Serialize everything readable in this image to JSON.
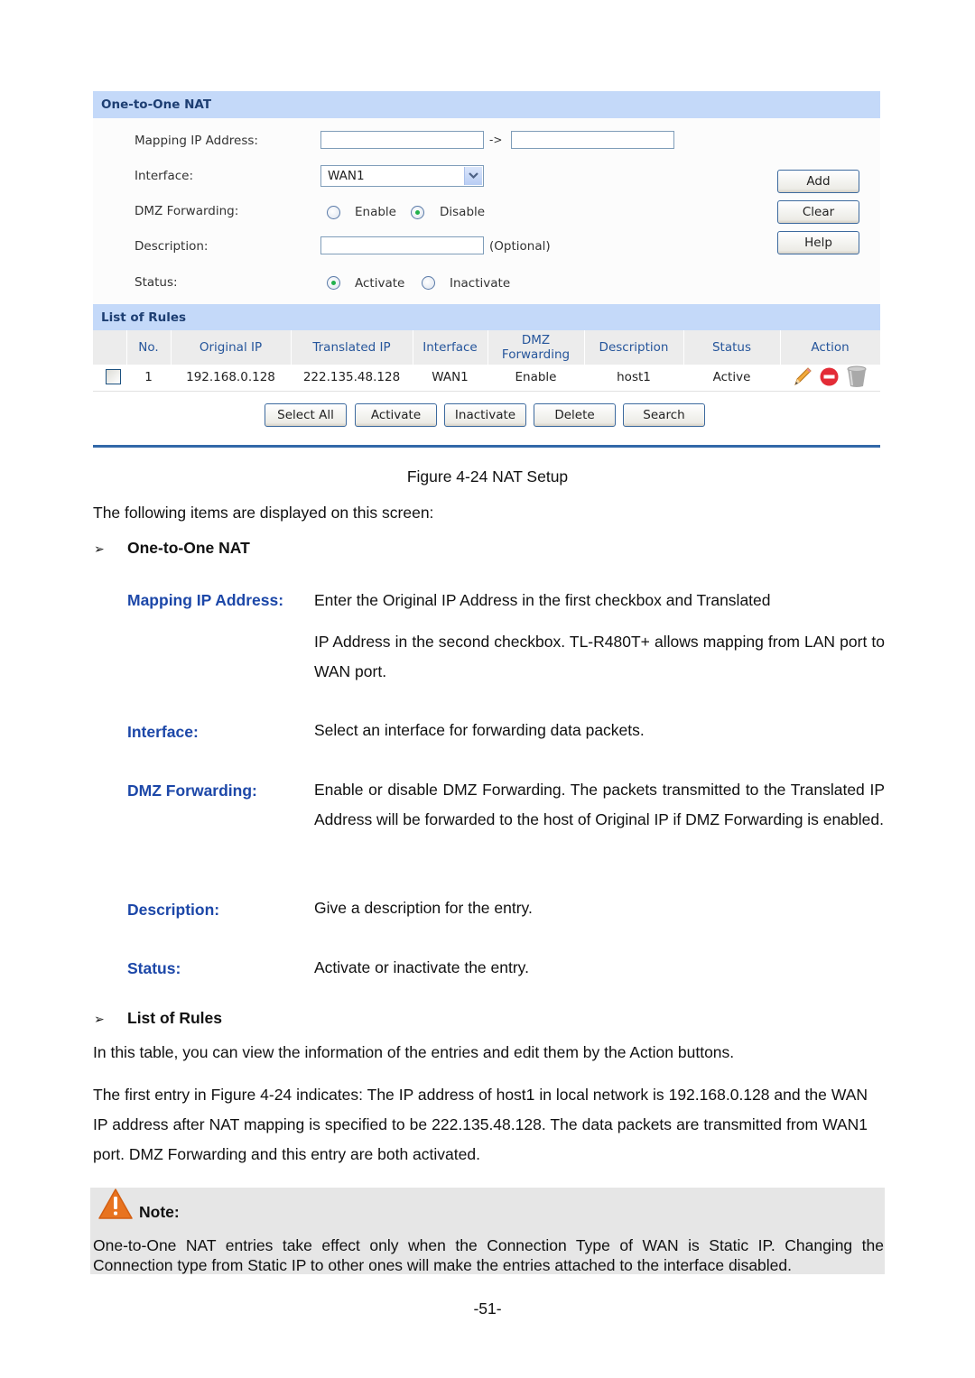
{
  "figure": {
    "one_to_one_section": {
      "title": "One-to-One NAT",
      "fields": {
        "mapping_ip_label": "Mapping IP Address:",
        "mapping_ip_original_value": "",
        "mapping_arrow": "->",
        "mapping_ip_translated_value": "",
        "interface_label": "Interface:",
        "interface_selected": "WAN1",
        "dmz_label": "DMZ Forwarding:",
        "dmz_options": [
          "Enable",
          "Disable"
        ],
        "dmz_selected": "Disable",
        "description_label": "Description:",
        "description_value": "",
        "description_hint": "(Optional)",
        "status_label": "Status:",
        "status_options": [
          "Activate",
          "Inactivate"
        ],
        "status_selected": "Activate"
      },
      "buttons": {
        "add": "Add",
        "clear": "Clear",
        "help": "Help"
      }
    },
    "rules_section": {
      "title": "List of Rules",
      "columns": [
        "",
        "No.",
        "Original IP",
        "Translated IP",
        "Interface",
        "DMZ Forwarding",
        "Description",
        "Status",
        "Action"
      ],
      "column_dmz_line1": "DMZ",
      "column_dmz_line2": "Forwarding",
      "rows": [
        {
          "checked": false,
          "no": "1",
          "original_ip": "192.168.0.128",
          "translated_ip": "222.135.48.128",
          "interface": "WAN1",
          "dmz_forwarding": "Enable",
          "description": "host1",
          "status": "Active",
          "actions": [
            "edit-pencil-icon",
            "inactivate-minus-icon",
            "delete-trash-icon"
          ]
        }
      ],
      "buttons": {
        "select_all": "Select All",
        "activate": "Activate",
        "inactivate": "Inactivate",
        "delete": "Delete",
        "search": "Search"
      }
    },
    "caption": "Figure 4-24 NAT Setup"
  },
  "document": {
    "intro": "The following items are displayed on this screen:",
    "bullet_glyph": "➢",
    "section1_heading": "One-to-One NAT",
    "terms": [
      {
        "term": "Mapping IP Address:",
        "line1": "Enter the Original IP Address in the first checkbox and Translated",
        "rest": "IP Address in the second checkbox. TL-R480T+ allows mapping from LAN port to WAN port."
      },
      {
        "term": "Interface:",
        "text": "Select an interface for forwarding data packets."
      },
      {
        "term": "DMZ Forwarding:",
        "text": "Enable or disable DMZ Forwarding. The packets transmitted to the Translated IP Address will be forwarded to the host of Original IP if DMZ Forwarding is enabled."
      },
      {
        "term": "Description:",
        "text": "Give a description for the entry."
      },
      {
        "term": "Status:",
        "text": "Activate or inactivate the entry."
      }
    ],
    "section2_heading": "List of Rules",
    "para1": "In this table, you can view the information of the entries and edit them by the Action buttons.",
    "para2": "The first entry in Figure 4-24 indicates: The IP address of host1 in local network is 192.168.0.128 and the WAN IP address after NAT mapping is specified to be 222.135.48.128. The data packets are transmitted from WAN1 port. DMZ Forwarding and this entry are both activated.",
    "note_title": "Note:",
    "note_text": "One-to-One NAT entries take effect only when the Connection Type of WAN is Static IP. Changing the Connection type from Static IP to other ones will make the entries attached to the interface disabled.",
    "page_number": "-51-"
  },
  "colors": {
    "section_bar": "#c4d9f9",
    "section_title": "#1d3e72",
    "table_header_text": "#25559b",
    "term_blue": "#1c47a8",
    "rule_line": "#3268a8",
    "note_bg": "#e6e6e6",
    "warning_orange": "#e8731f"
  }
}
